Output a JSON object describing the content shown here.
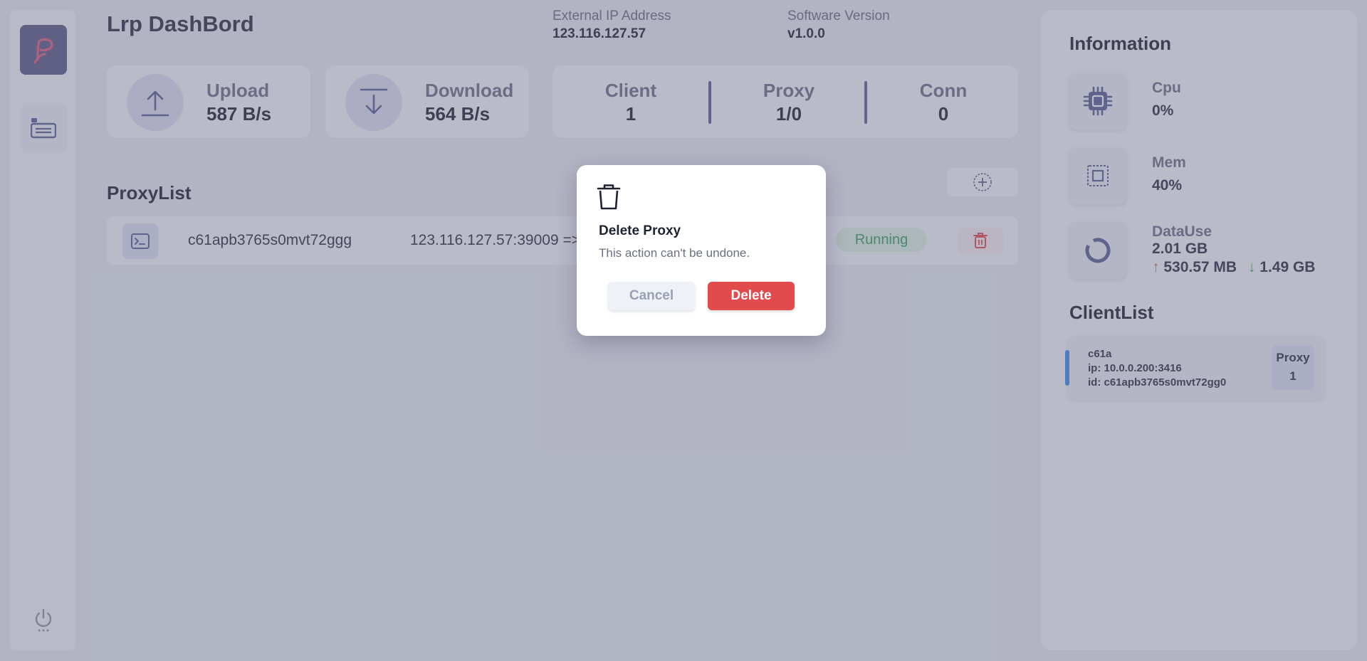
{
  "colors": {
    "accent": "#5c5f91",
    "danger": "#e24b4b",
    "running": "#3aa25a",
    "upload_arrow": "#e06a4c",
    "download_arrow": "#4aa85d",
    "client_bar": "#3f8be8"
  },
  "sidebar": {
    "logo_icon": "brand-logo-icon",
    "nav_icon": "dashboard-icon",
    "power_icon": "power-icon"
  },
  "header": {
    "title": "Lrp DashBord",
    "ip_label": "External IP Address",
    "ip_value": "123.116.127.57",
    "version_label": "Software Version",
    "version_value": "v1.0.0"
  },
  "stats": {
    "upload": {
      "label": "Upload",
      "value": "587 B/s"
    },
    "download": {
      "label": "Download",
      "value": "564 B/s"
    },
    "client": {
      "label": "Client",
      "value": "1"
    },
    "proxy": {
      "label": "Proxy",
      "value": "1/0"
    },
    "conn": {
      "label": "Conn",
      "value": "0"
    }
  },
  "proxy_list": {
    "title": "ProxyList",
    "rows": [
      {
        "id": "c61apb3765s0mvt72ggg",
        "address": "123.116.127.57:39009 =>",
        "status": "Running"
      }
    ]
  },
  "information": {
    "title": "Information",
    "cpu": {
      "label": "Cpu",
      "value": "0%"
    },
    "mem": {
      "label": "Mem",
      "value": "40%"
    },
    "data_use": {
      "label": "DataUse",
      "total": "2.01 GB",
      "up_arrow": "↑",
      "up": "530.57 MB",
      "down_arrow": "↓",
      "down": "1.49 GB"
    }
  },
  "client_list": {
    "title": "ClientList",
    "clients": [
      {
        "name": "c61a",
        "ip": "ip: 10.0.0.200:3416",
        "id": "id: c61apb3765s0mvt72gg0",
        "proxy_label": "Proxy",
        "proxy_count": "1"
      }
    ]
  },
  "modal": {
    "icon": "trash-icon",
    "title": "Delete Proxy",
    "description": "This action can't be undone.",
    "cancel_label": "Cancel",
    "delete_label": "Delete"
  }
}
